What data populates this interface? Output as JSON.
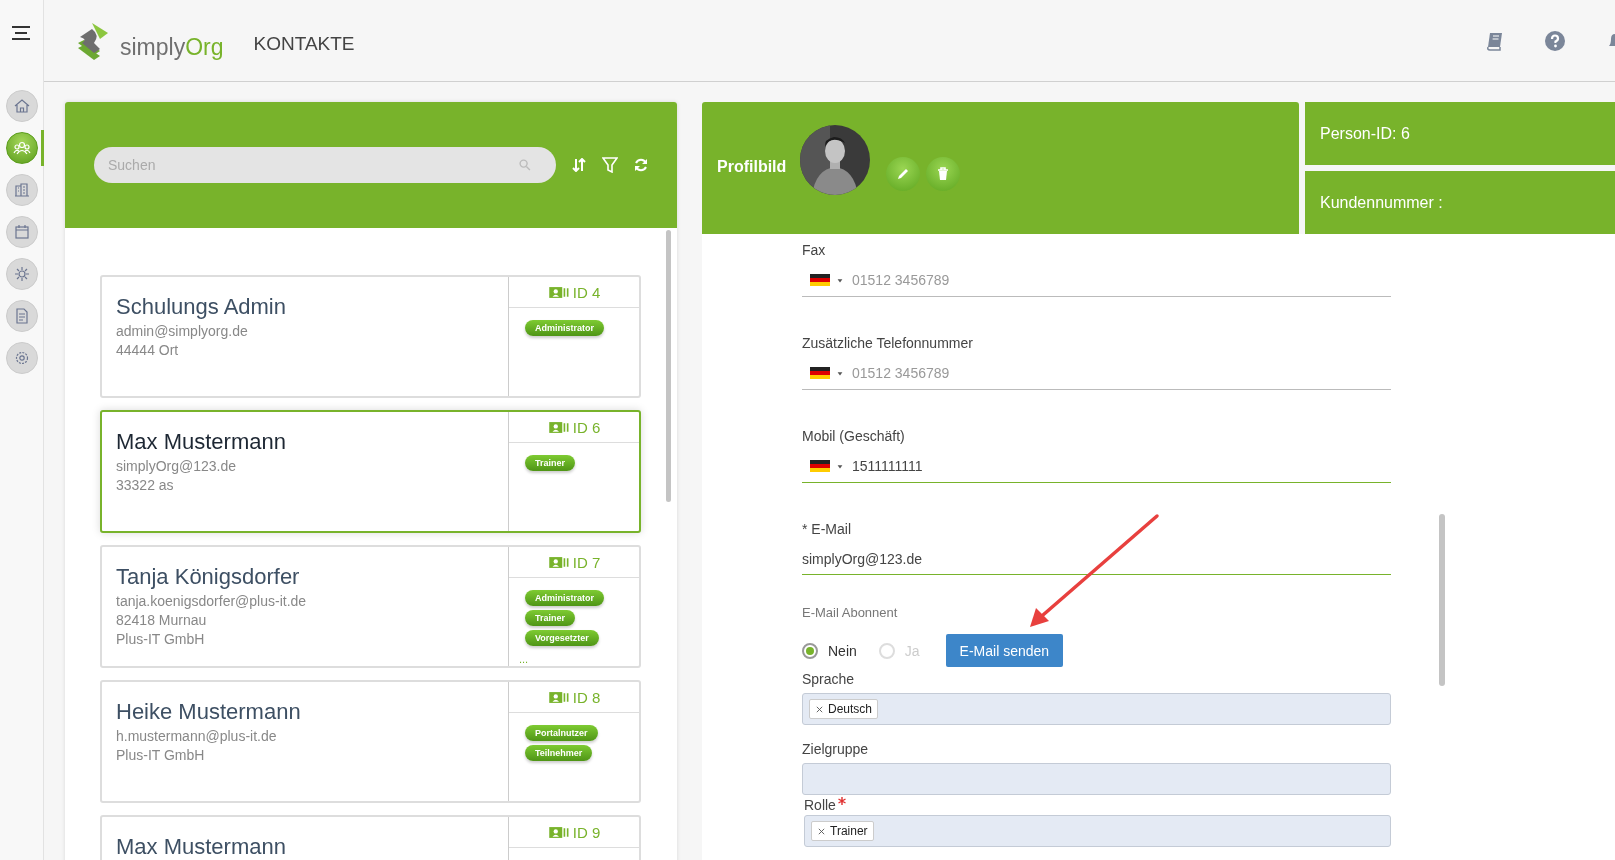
{
  "header": {
    "logo": {
      "first": "simply",
      "second": "Org"
    },
    "title": "KONTAKTE"
  },
  "sidebar": {
    "items": [
      {
        "selected": false
      },
      {
        "selected": true
      },
      {
        "selected": false
      },
      {
        "selected": false
      },
      {
        "selected": false
      },
      {
        "selected": false
      },
      {
        "selected": false
      }
    ]
  },
  "contacts": {
    "search": {
      "placeholder": "Suchen"
    },
    "cards": [
      {
        "name": "Schulungs Admin",
        "lines": [
          "admin@simplyorg.de",
          "44444 Ort"
        ],
        "id": "ID 4",
        "roles": [
          "Administrator"
        ],
        "selected": false
      },
      {
        "name": "Max Mustermann",
        "lines": [
          "simplyOrg@123.de",
          "33322 as"
        ],
        "id": "ID 6",
        "roles": [
          "Trainer"
        ],
        "selected": true
      },
      {
        "name": "Tanja Königsdorfer",
        "lines": [
          "tanja.koenigsdorfer@plus-it.de",
          "82418 Murnau",
          "Plus-IT GmbH"
        ],
        "id": "ID 7",
        "roles": [
          "Administrator",
          "Trainer",
          "Vorgesetzter"
        ],
        "overflow": "...",
        "selected": false
      },
      {
        "name": "Heike Mustermann",
        "lines": [
          "h.mustermann@plus-it.de",
          "Plus-IT GmbH"
        ],
        "id": "ID 8",
        "roles": [
          "Portalnutzer",
          "Teilnehmer"
        ],
        "selected": false
      },
      {
        "name": "Max Mustermann",
        "id": "ID 9",
        "selected": false
      }
    ]
  },
  "profile": {
    "label": "Profilbild",
    "person_id": "Person-ID: 6",
    "customer_number": "Kundennummer :"
  },
  "form": {
    "fields": [
      {
        "kind": "phone",
        "label": "Fax",
        "placeholder": "01512 3456789"
      },
      {
        "kind": "phone",
        "label": "Zusätzliche Telefonnummer",
        "placeholder": "01512 3456789"
      },
      {
        "kind": "phone",
        "label": "Mobil (Geschäft)",
        "value": "1511111111"
      },
      {
        "kind": "text",
        "label": "* E-Mail",
        "value": "simplyOrg@123.de"
      },
      {
        "kind": "radio",
        "label": "E-Mail Abonnent",
        "options": [
          {
            "label": "Nein",
            "selected": true,
            "disabled": false
          },
          {
            "label": "Ja",
            "selected": false,
            "disabled": true
          }
        ],
        "button": "E-Mail senden"
      },
      {
        "kind": "tags",
        "label": "Sprache",
        "required": false,
        "tags": [
          "Deutsch"
        ]
      },
      {
        "kind": "tags",
        "label": "Zielgruppe",
        "required": false
      },
      {
        "kind": "tags",
        "label": "Rolle",
        "required": true,
        "tags": [
          "Trainer"
        ]
      }
    ]
  }
}
